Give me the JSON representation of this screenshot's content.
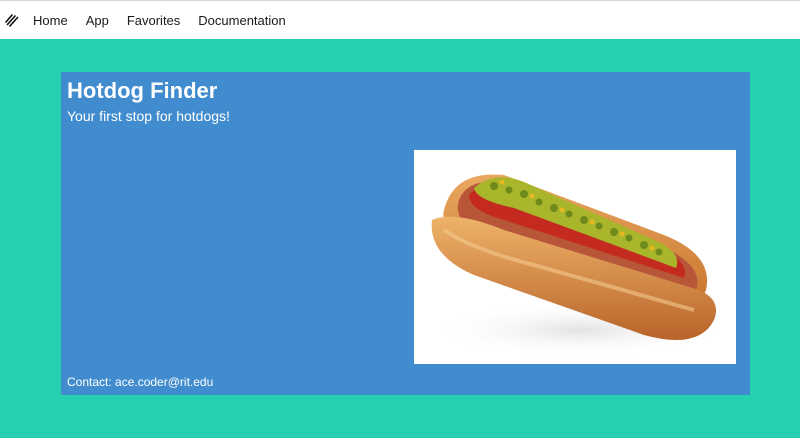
{
  "nav": {
    "logo_icon": "striped-logo-icon",
    "links": [
      "Home",
      "App",
      "Favorites",
      "Documentation"
    ]
  },
  "hero": {
    "title": "Hotdog Finder",
    "subtitle": "Your first stop for hotdogs!",
    "image_icon": "hotdog-photo",
    "contact": "Contact: ace.coder@rit.edu"
  },
  "colors": {
    "page_background": "#24d0b0",
    "card_background": "#418cce",
    "nav_background": "#ffffff",
    "text_on_card": "#ffffff"
  }
}
